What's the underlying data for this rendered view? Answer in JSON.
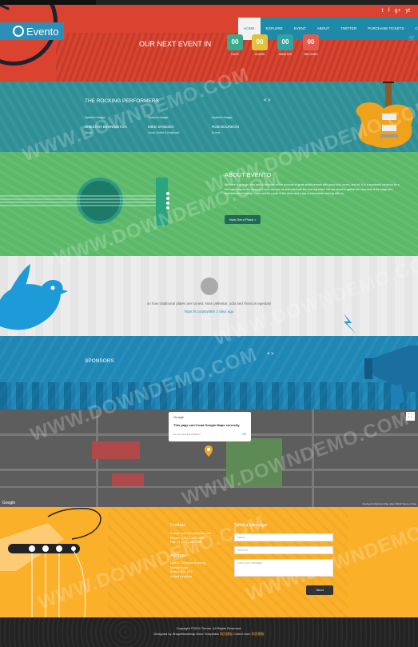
{
  "brand": {
    "name": "Evento"
  },
  "colors": {
    "hero": "#d9432f",
    "nav": "#1f8aa8",
    "performers": "#2f8f96",
    "about": "#5cb96a",
    "sponsors": "#1e87b6",
    "contact": "#fbb02a",
    "footer": "#232323",
    "countdown": [
      "#3aa98d",
      "#e3c23b",
      "#2fa4a0",
      "#e35b4f"
    ]
  },
  "social": [
    "t",
    "f",
    "g+",
    "yt"
  ],
  "nav": [
    "HOME",
    "EXPLORE",
    "EVENT",
    "ABOUT",
    "TWITTER",
    "PURCHASE TICKETS",
    "CONTACT"
  ],
  "hero": {
    "title": "OUR NEXT EVENT IN",
    "countdown": [
      {
        "value": "00",
        "label": "DAYS"
      },
      {
        "value": "00",
        "label": "HOURS"
      },
      {
        "value": "00",
        "label": "MINUTES"
      },
      {
        "value": "00",
        "label": "SECONDS"
      }
    ]
  },
  "performers": {
    "title": "THE ROCKING PERFORMERS",
    "items": [
      {
        "img": "Speech image",
        "name": "CHESTER BENNINGTON",
        "role": "Vocal"
      },
      {
        "img": "Speech image",
        "name": "MIKE SHINODA",
        "role": "Vocal, Guitar & Keyboard"
      },
      {
        "img": "Speech image",
        "name": "ROB BOURDON",
        "role": "Drums"
      }
    ]
  },
  "about": {
    "title": "ABOUT EVENTO",
    "text": "We have a lot to go over and to discover on the account of great artistic events with good food, music, and art. It is a wonderful occasion for a free open day on the campus. Come and join us and celebrate the next big event. We are proud to gather the very best of the stage and entertainment industry. Come and be a part of the show and enjoy a memorable evening with us.",
    "button": "Now Get a Place >"
  },
  "twitter": {
    "tweet": "on how traditional plates are turned. Note pellentar, odio sed rhoncus egestas!",
    "link": "https://t.co/pEy88m 2 days ago"
  },
  "sponsors": {
    "title": "SPONSORS",
    "arrows": "< >"
  },
  "map": {
    "dialog": {
      "google": "Google",
      "title": "This page can't load Google Maps correctly.",
      "subtitle": "Do you own this website?",
      "ok": "OK"
    },
    "google_logo": "Google",
    "attribution": "Keyboard shortcuts  Map data ©2024  Terms of Use",
    "fullscreen": "⛶"
  },
  "contact": {
    "title": "Contact",
    "email": "E-mail: yourname@gmail.com",
    "phone": "Phone: +(00) 0-456-7890",
    "fax": "Fax: +1 (012) 456-7890",
    "address_title": "Address",
    "address": [
      "Unit 12, Olympus Building,",
      "Market Road,",
      "Bristol, BS1 2XY",
      "United Kingdom"
    ],
    "form_title": "Send a Message",
    "name_ph": "Name",
    "email_ph": "Email ID",
    "message_ph": "Enter your message",
    "send": "Send"
  },
  "footer": {
    "line1": "Copyright ©2024 Theme. All Rights Reserved.",
    "line2a": "Designed by ShapeBootstrap More Templates",
    "line2b": "Collect from"
  },
  "watermark": "WWW.DOWNDEMO.COM"
}
